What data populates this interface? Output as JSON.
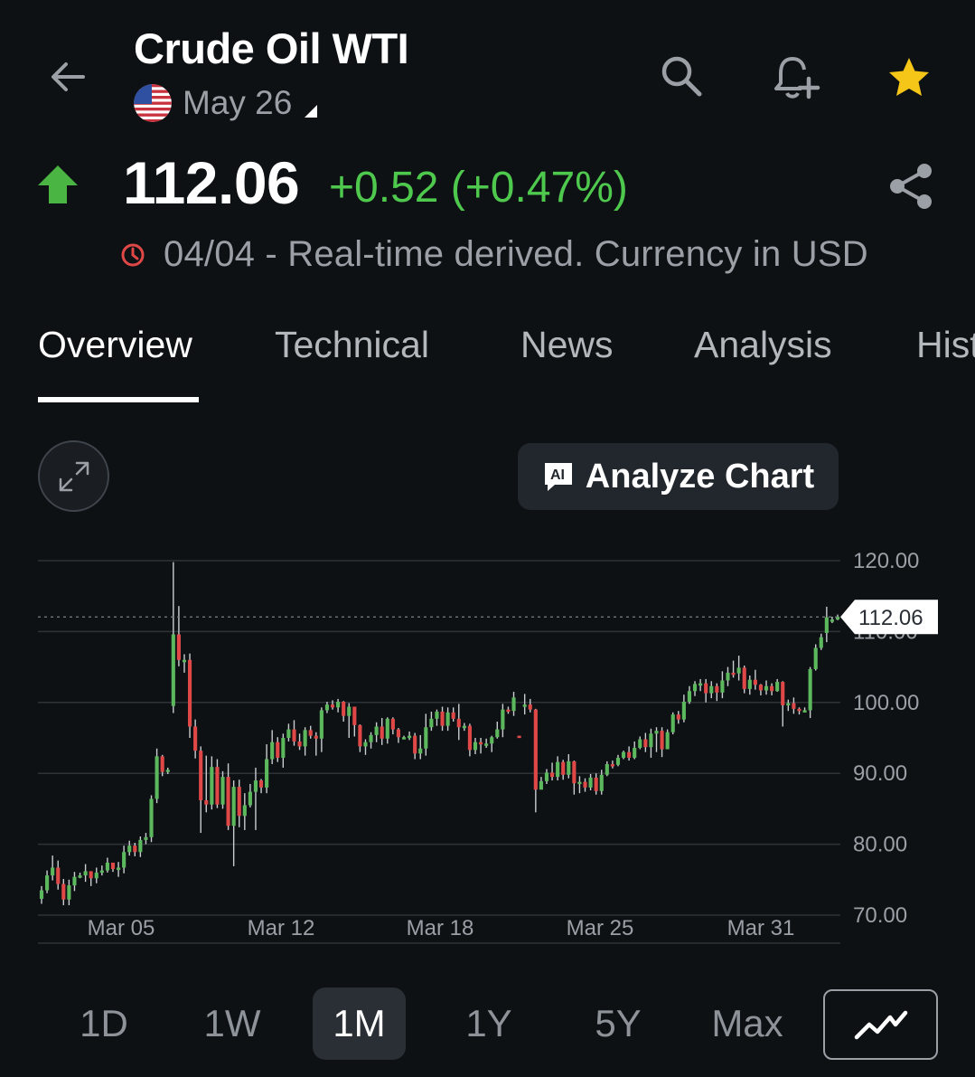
{
  "header": {
    "title": "Crude Oil WTI",
    "contract": "May 26"
  },
  "quote": {
    "price": "112.06",
    "change": "+0.52 (+0.47%)",
    "status": "04/04 - Real-time derived. Currency in USD",
    "direction": "up"
  },
  "tabs": [
    "Overview",
    "Technical",
    "News",
    "Analysis",
    "Hist"
  ],
  "active_tab": "Overview",
  "analyze_label": "Analyze Chart",
  "ranges": [
    "1D",
    "1W",
    "1M",
    "1Y",
    "5Y",
    "Max"
  ],
  "active_range": "1M",
  "icons": {
    "back": "back-arrow-icon",
    "search": "search-icon",
    "alert": "bell-plus-icon",
    "favorite": "star-icon",
    "share": "share-icon",
    "clock": "clock-icon",
    "expand": "expand-icon",
    "ai": "ai-chat-icon",
    "chart_type": "line-chart-icon"
  },
  "colors": {
    "background": "#0e1114",
    "up": "#5cb85c",
    "down": "#e04848",
    "change_text": "#4ec94e",
    "star": "#f5c518",
    "muted": "#9aa0a6"
  },
  "chart_data": {
    "type": "candlestick",
    "x_tick_labels": [
      "Mar 05",
      "Mar 12",
      "Mar 18",
      "Mar 25",
      "Mar 31"
    ],
    "y_tick_labels": [
      "120.00",
      "110.00",
      "100.00",
      "90.00",
      "80.00",
      "70.00"
    ],
    "ylim": [
      70,
      120
    ],
    "grid": true,
    "last_price": "112.06",
    "candles": [
      [
        72.3,
        73.5,
        71.6,
        74.1
      ],
      [
        73.5,
        75.6,
        73.1,
        76.3
      ],
      [
        75.6,
        76.7,
        74.9,
        78.4
      ],
      [
        76.7,
        74.4,
        73.6,
        77.7
      ],
      [
        74.4,
        72.2,
        71.4,
        75.1
      ],
      [
        72.2,
        74.2,
        71.4,
        75.0
      ],
      [
        74.2,
        75.4,
        73.4,
        76.1
      ],
      [
        75.4,
        75.6,
        75.2,
        76.0
      ],
      [
        75.6,
        76.2,
        74.7,
        77.2
      ],
      [
        76.2,
        75.2,
        74.1,
        76.0
      ],
      [
        75.2,
        76.0,
        74.5,
        76.7
      ],
      [
        76.0,
        76.3,
        75.6,
        77.0
      ],
      [
        76.3,
        77.4,
        76.0,
        78.1
      ],
      [
        77.4,
        76.5,
        76.1,
        77.1
      ],
      [
        76.5,
        76.7,
        75.4,
        77.5
      ],
      [
        76.7,
        78.9,
        75.9,
        79.8
      ],
      [
        78.9,
        79.8,
        78.4,
        80.5
      ],
      [
        79.8,
        78.9,
        78.3,
        80.2
      ],
      [
        78.9,
        80.6,
        78.2,
        81.1
      ],
      [
        80.6,
        81.0,
        80.0,
        81.6
      ],
      [
        81.0,
        86.4,
        80.3,
        86.9
      ],
      [
        86.4,
        92.4,
        85.8,
        93.5
      ],
      [
        92.4,
        90.2,
        89.6,
        92.6
      ],
      [
        90.2,
        90.5,
        89.9,
        90.8
      ],
      [
        99.5,
        109.6,
        98.5,
        119.8
      ],
      [
        109.6,
        106.0,
        105.1,
        113.6
      ],
      [
        106.0,
        106.0,
        104.2,
        106.8
      ],
      [
        106.0,
        96.6,
        95.0,
        106.9
      ],
      [
        96.6,
        93.2,
        92.1,
        97.6
      ],
      [
        93.2,
        86.2,
        81.6,
        93.8
      ],
      [
        86.2,
        85.6,
        84.5,
        92.5
      ],
      [
        85.6,
        90.9,
        84.9,
        92.4
      ],
      [
        90.9,
        85.6,
        85.1,
        92.0
      ],
      [
        85.6,
        89.5,
        85.0,
        90.3
      ],
      [
        89.5,
        82.6,
        82.0,
        91.4
      ],
      [
        82.6,
        88.1,
        76.9,
        89.0
      ],
      [
        88.1,
        84.0,
        82.4,
        89.1
      ],
      [
        84.0,
        85.5,
        82.0,
        87.2
      ],
      [
        85.5,
        87.4,
        85.2,
        88.5
      ],
      [
        87.4,
        89.0,
        82.0,
        90.8
      ],
      [
        89.0,
        88.0,
        87.2,
        89.2
      ],
      [
        88.0,
        92.0,
        87.2,
        94.1
      ],
      [
        92.0,
        94.4,
        91.3,
        96.1
      ],
      [
        94.4,
        92.2,
        91.6,
        95.1
      ],
      [
        92.2,
        95.0,
        90.8,
        95.6
      ],
      [
        95.0,
        96.2,
        94.5,
        97.0
      ],
      [
        96.2,
        94.5,
        93.9,
        97.5
      ],
      [
        94.5,
        93.8,
        93.3,
        95.6
      ],
      [
        93.8,
        96.1,
        92.5,
        96.5
      ],
      [
        96.1,
        95.3,
        94.9,
        96.7
      ],
      [
        95.3,
        94.9,
        92.5,
        95.8
      ],
      [
        94.9,
        98.9,
        93.0,
        99.3
      ],
      [
        98.9,
        99.7,
        98.5,
        100.1
      ],
      [
        99.7,
        99.3,
        99.0,
        100.3
      ],
      [
        99.3,
        100.1,
        98.6,
        100.5
      ],
      [
        100.1,
        98.1,
        97.3,
        100.2
      ],
      [
        98.1,
        99.4,
        95.0,
        99.9
      ],
      [
        99.4,
        96.8,
        95.2,
        98.4
      ],
      [
        96.8,
        93.8,
        93.0,
        96.9
      ],
      [
        93.8,
        94.4,
        92.6,
        94.8
      ],
      [
        94.4,
        95.4,
        93.5,
        95.8
      ],
      [
        95.4,
        96.6,
        94.4,
        97.2
      ],
      [
        96.6,
        94.9,
        94.0,
        97.8
      ],
      [
        94.9,
        97.7,
        94.2,
        97.9
      ],
      [
        97.7,
        96.2,
        95.5,
        97.9
      ],
      [
        96.2,
        95.1,
        94.3,
        96.4
      ],
      [
        95.1,
        95.1,
        94.8,
        95.3
      ],
      [
        95.1,
        95.3,
        94.7,
        95.9
      ],
      [
        95.3,
        92.8,
        92.0,
        95.7
      ],
      [
        92.8,
        93.5,
        92.0,
        95.4
      ],
      [
        93.5,
        96.5,
        92.5,
        98.4
      ],
      [
        96.5,
        97.7,
        96.0,
        98.7
      ],
      [
        97.7,
        98.7,
        96.7,
        99.0
      ],
      [
        98.7,
        96.7,
        96.0,
        99.4
      ],
      [
        96.7,
        98.6,
        96.0,
        99.3
      ],
      [
        98.6,
        97.7,
        97.3,
        99.3
      ],
      [
        97.7,
        96.5,
        94.7,
        99.8
      ],
      [
        96.5,
        96.7,
        96.0,
        97.1
      ],
      [
        96.7,
        93.3,
        92.4,
        97.0
      ],
      [
        93.3,
        94.4,
        92.7,
        95.0
      ],
      [
        94.4,
        94.1,
        92.8,
        95.0
      ],
      [
        94.1,
        94.2,
        93.6,
        94.9
      ],
      [
        94.2,
        95.1,
        93.0,
        95.3
      ],
      [
        95.1,
        96.2,
        94.9,
        97.3
      ],
      [
        96.2,
        99.0,
        95.1,
        99.8
      ],
      [
        99.0,
        98.8,
        98.4,
        99.4
      ],
      [
        98.8,
        100.7,
        98.1,
        101.5
      ],
      [
        95.3,
        95.2,
        95.1,
        95.3
      ],
      [
        99.6,
        99.7,
        98.3,
        101.2
      ],
      [
        99.7,
        99.0,
        98.6,
        100.5
      ],
      [
        99.0,
        87.7,
        84.5,
        99.1
      ],
      [
        87.7,
        88.9,
        88.1,
        89.5
      ],
      [
        88.9,
        90.1,
        88.5,
        90.6
      ],
      [
        90.1,
        89.5,
        89.0,
        91.5
      ],
      [
        89.5,
        91.6,
        89.0,
        92.4
      ],
      [
        91.6,
        89.8,
        89.1,
        91.9
      ],
      [
        89.8,
        91.7,
        89.3,
        92.7
      ],
      [
        91.7,
        88.6,
        87.0,
        91.8
      ],
      [
        88.6,
        88.8,
        87.2,
        89.6
      ],
      [
        88.8,
        88.0,
        87.4,
        89.3
      ],
      [
        88.0,
        89.4,
        87.6,
        89.9
      ],
      [
        89.4,
        87.5,
        87.0,
        90.0
      ],
      [
        87.5,
        89.8,
        87.0,
        90.5
      ],
      [
        89.8,
        91.3,
        89.6,
        91.7
      ],
      [
        91.3,
        91.2,
        90.7,
        91.8
      ],
      [
        91.2,
        92.2,
        91.0,
        92.6
      ],
      [
        92.2,
        93.0,
        92.0,
        93.2
      ],
      [
        93.0,
        92.2,
        91.8,
        93.8
      ],
      [
        92.2,
        93.6,
        92.0,
        94.5
      ],
      [
        93.6,
        94.8,
        93.4,
        95.2
      ],
      [
        94.8,
        93.7,
        93.0,
        95.7
      ],
      [
        93.7,
        95.6,
        92.2,
        96.3
      ],
      [
        95.6,
        96.0,
        93.0,
        96.5
      ],
      [
        96.0,
        93.4,
        92.3,
        96.5
      ],
      [
        93.4,
        95.8,
        93.4,
        96.2
      ],
      [
        95.8,
        98.3,
        95.5,
        98.6
      ],
      [
        98.3,
        97.6,
        97.0,
        98.8
      ],
      [
        97.6,
        100.1,
        97.2,
        101.1
      ],
      [
        100.1,
        101.6,
        99.8,
        102.3
      ],
      [
        101.6,
        102.6,
        100.9,
        103.0
      ],
      [
        102.6,
        102.7,
        101.6,
        103.3
      ],
      [
        102.7,
        101.3,
        100.0,
        103.3
      ],
      [
        101.3,
        102.3,
        100.6,
        103.0
      ],
      [
        102.3,
        101.4,
        100.2,
        102.7
      ],
      [
        101.4,
        103.1,
        100.6,
        104.4
      ],
      [
        103.1,
        104.2,
        102.3,
        105.0
      ],
      [
        104.2,
        104.1,
        103.5,
        105.9
      ],
      [
        104.1,
        104.9,
        103.1,
        106.6
      ],
      [
        104.9,
        101.9,
        101.3,
        105.2
      ],
      [
        101.9,
        103.2,
        101.1,
        103.8
      ],
      [
        103.2,
        102.5,
        101.8,
        104.6
      ],
      [
        102.5,
        101.7,
        101.0,
        102.6
      ],
      [
        101.7,
        102.3,
        101.1,
        103.1
      ],
      [
        102.3,
        101.6,
        101.0,
        102.7
      ],
      [
        101.6,
        102.9,
        101.5,
        103.3
      ],
      [
        102.9,
        99.6,
        96.6,
        103.0
      ],
      [
        99.6,
        99.9,
        98.8,
        100.4
      ],
      [
        99.9,
        99.1,
        98.4,
        100.7
      ],
      [
        99.1,
        98.9,
        98.3,
        99.3
      ],
      [
        98.9,
        98.9,
        98.6,
        99.3
      ],
      [
        98.9,
        104.7,
        97.8,
        105.0
      ],
      [
        104.7,
        107.7,
        104.5,
        108.2
      ],
      [
        107.7,
        109.2,
        107.4,
        109.7
      ],
      [
        109.8,
        112.0,
        108.5,
        113.5
      ],
      [
        111.5,
        111.7,
        111.2,
        112.1
      ],
      [
        111.7,
        112.1,
        111.6,
        112.4
      ]
    ]
  }
}
